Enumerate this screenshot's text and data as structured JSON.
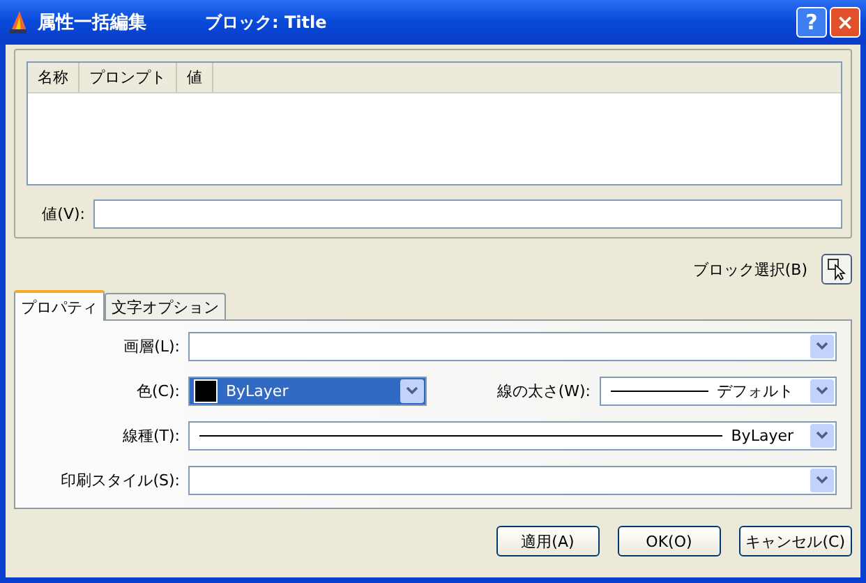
{
  "window": {
    "title": "属性一括編集",
    "block": "ブロック: Title",
    "help_button": "?",
    "close_button": "×"
  },
  "attribute_list": {
    "columns": [
      "名称",
      "プロンプト",
      "値"
    ]
  },
  "value_field": {
    "label": "値(V):"
  },
  "block_select": {
    "label": "ブロック選択(B)"
  },
  "tabs": [
    {
      "label": "プロパティ",
      "selected": true
    },
    {
      "label": "文字オプション",
      "selected": false
    }
  ],
  "rows": [
    {
      "fields": [
        {
          "label": "画層(L):",
          "focused": false
        }
      ]
    },
    {
      "fields": [
        {
          "label": "色(C):",
          "value": "ByLayer",
          "color": "#000000",
          "focused": true
        },
        {
          "label": "線の太さ(W):",
          "value": "デフォルト",
          "line_sample": true,
          "focused": false
        }
      ]
    },
    {
      "fields": [
        {
          "label": "線種(T):",
          "value": "ByLayer",
          "line_sample": true,
          "focused": false
        }
      ]
    },
    {
      "fields": [
        {
          "label": "印刷スタイル(S):",
          "focused": false
        }
      ]
    }
  ],
  "buttons": [
    "適用(A)",
    "OK(O)",
    "キャンセル(C)"
  ]
}
